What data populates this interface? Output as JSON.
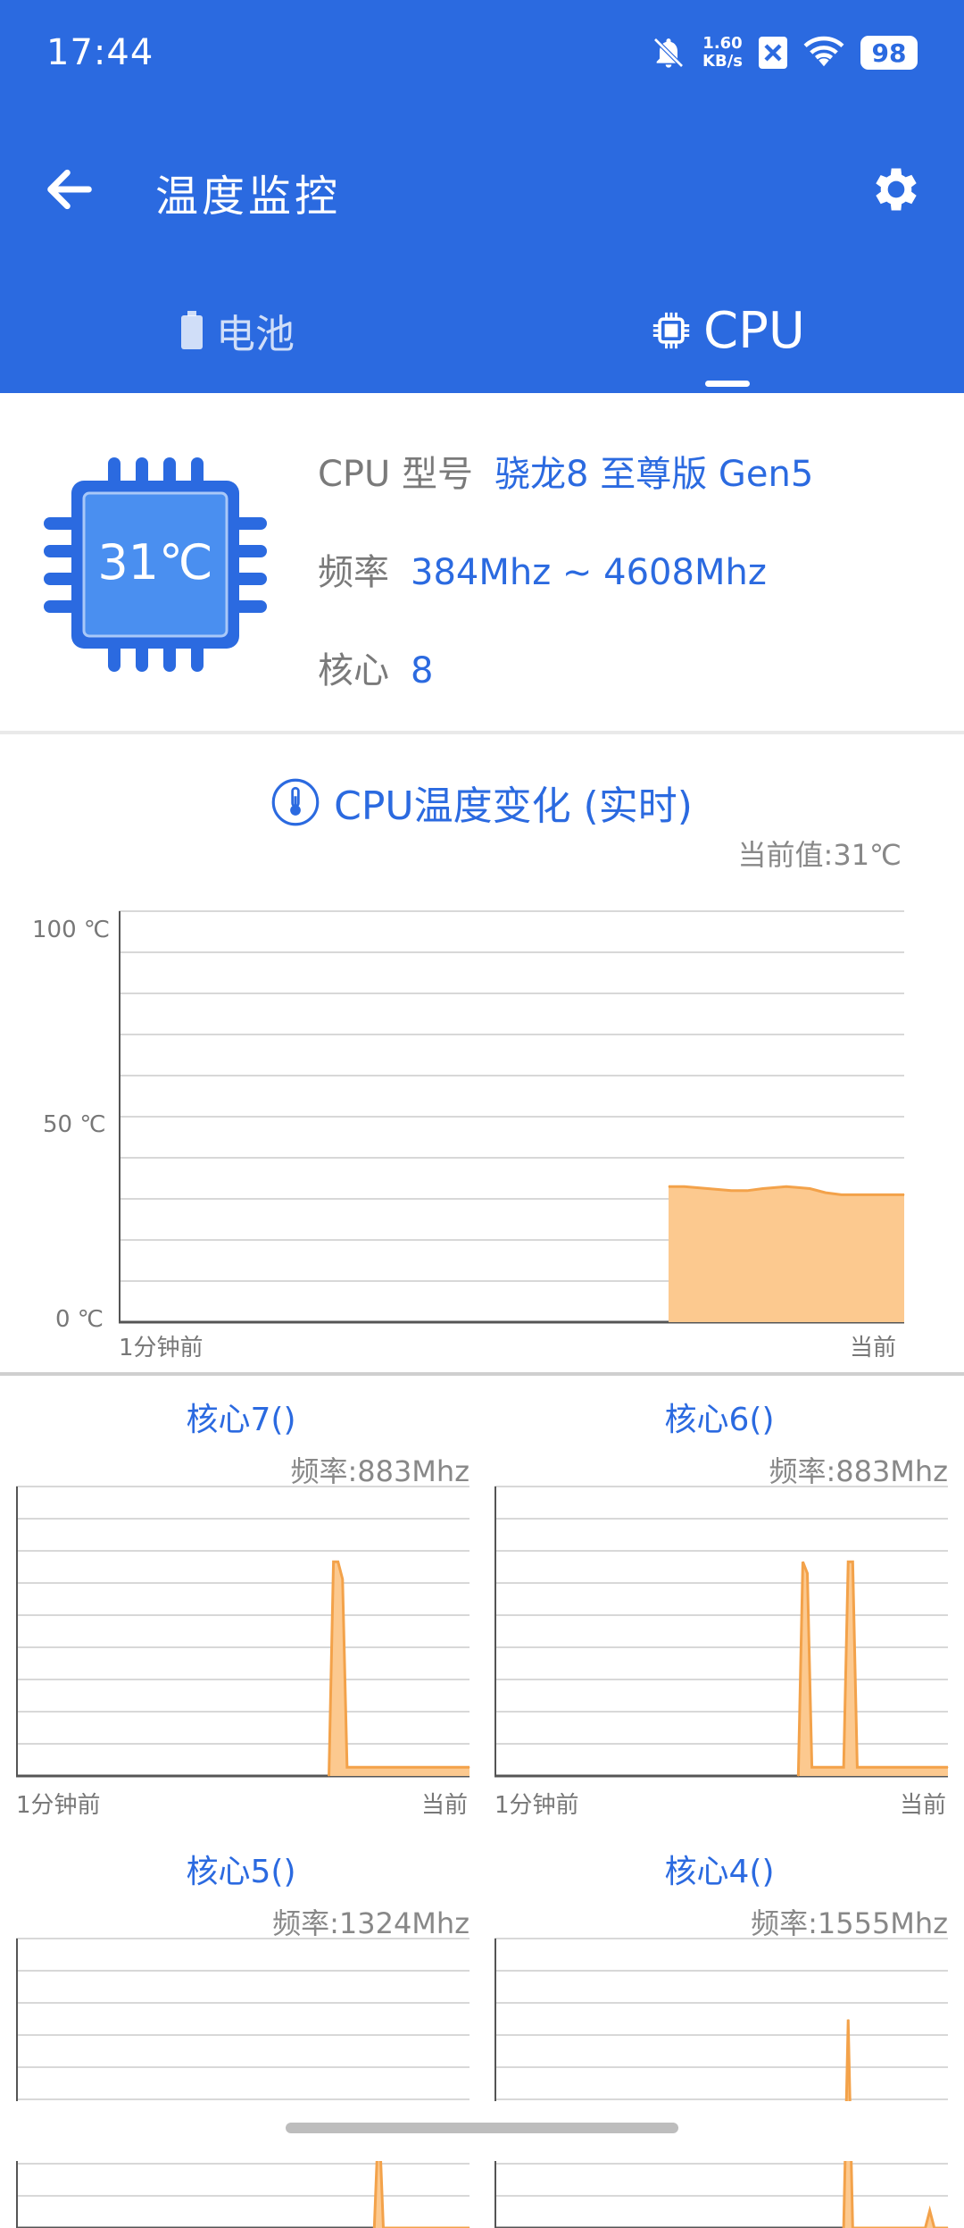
{
  "status": {
    "time": "17:44",
    "net_speed_top": "1.60",
    "net_speed_bottom": "KB/s",
    "battery": "98"
  },
  "toolbar": {
    "title": "温度监控"
  },
  "tabs": [
    {
      "label": "电池",
      "selected": false
    },
    {
      "label": "CPU",
      "selected": true
    }
  ],
  "cpu_info": {
    "chip_temp": "31℃",
    "model_label": "CPU 型号",
    "model_value": "骁龙8 至尊版 Gen5",
    "freq_label": "频率",
    "freq_value": "384Mhz ~ 4608Mhz",
    "cores_label": "核心",
    "cores_value": "8"
  },
  "temp_chart": {
    "title": "CPU温度变化 (实时)",
    "current": "当前值:31℃",
    "y_ticks": [
      "100 ℃",
      "50 ℃",
      "0 ℃"
    ],
    "x_start": "1分钟前",
    "x_end": "当前"
  },
  "cores": [
    {
      "title": "核心7()",
      "freq": "频率:883Mhz",
      "x_start": "1分钟前",
      "x_end": "当前"
    },
    {
      "title": "核心6()",
      "freq": "频率:883Mhz",
      "x_start": "1分钟前",
      "x_end": "当前"
    },
    {
      "title": "核心5()",
      "freq": "频率:1324Mhz"
    },
    {
      "title": "核心4()",
      "freq": "频率:1555Mhz"
    }
  ],
  "colors": {
    "primary": "#2b6ae0",
    "series_fill": "#fcc98f",
    "series_line": "#f3a24a"
  },
  "chart_data": [
    {
      "type": "area",
      "title": "CPU温度变化 (实时)",
      "ylabel": "℃",
      "ylim": [
        0,
        100
      ],
      "x_range": [
        "1分钟前",
        "当前"
      ],
      "series": [
        {
          "x": [
            0.7,
            0.72,
            0.75,
            0.78,
            0.8,
            0.82,
            0.85,
            0.88,
            0.9,
            0.92,
            0.95,
            1.0
          ],
          "values": [
            33,
            33,
            32.5,
            32,
            32,
            32.5,
            33,
            32.5,
            31.5,
            31,
            31,
            31
          ]
        }
      ],
      "grid": true
    },
    {
      "type": "area",
      "title": "核心7()",
      "ylim": [
        0,
        1
      ],
      "series": [
        {
          "x": [
            0.69,
            0.7,
            0.71,
            0.72,
            0.73,
            1.0
          ],
          "values": [
            0,
            0.74,
            0.74,
            0.68,
            0.03,
            0.03
          ]
        }
      ]
    },
    {
      "type": "area",
      "title": "核心6()",
      "ylim": [
        0,
        1
      ],
      "series": [
        {
          "x": [
            0.67,
            0.68,
            0.69,
            0.7,
            0.71,
            0.76,
            0.77,
            0.78,
            0.79,
            0.8,
            1.0
          ],
          "values": [
            0,
            0.74,
            0.7,
            0.03,
            0.03,
            0.03,
            0.03,
            0.74,
            0.74,
            0.03,
            0.03
          ]
        }
      ]
    },
    {
      "type": "area",
      "title": "核心5()",
      "ylim": [
        0,
        1
      ],
      "series": [
        {
          "x": [
            0.79,
            0.8,
            0.81,
            1.0
          ],
          "values": [
            0,
            0.4,
            0,
            0
          ]
        }
      ]
    },
    {
      "type": "area",
      "title": "核心4()",
      "ylim": [
        0,
        1
      ],
      "series": [
        {
          "x": [
            0.77,
            0.78,
            0.79,
            0.95,
            0.96,
            0.97,
            1.0
          ],
          "values": [
            0,
            0.72,
            0,
            0,
            0.06,
            0,
            0
          ]
        }
      ]
    }
  ]
}
